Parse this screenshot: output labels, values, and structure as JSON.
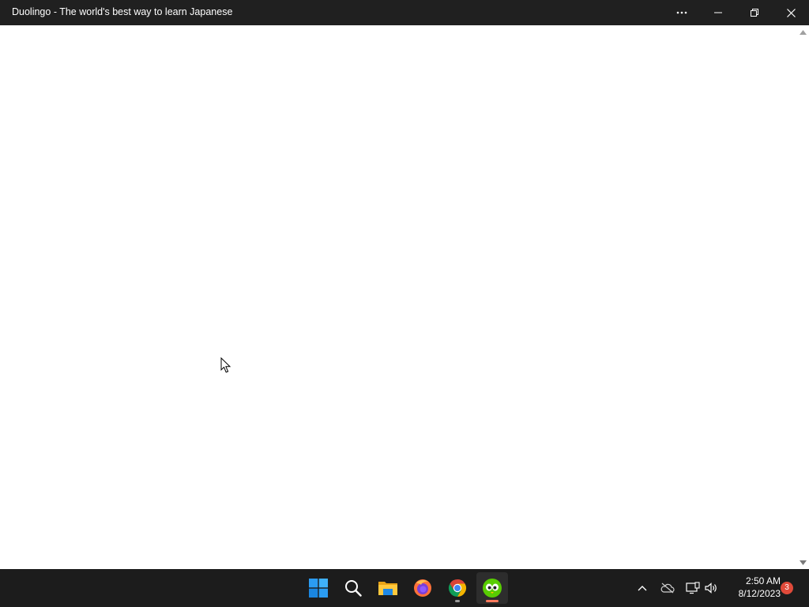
{
  "window": {
    "title": "Duolingo - The world's best way to learn Japanese",
    "controls": {
      "more_icon": "more-horizontal-icon",
      "minimize_icon": "minimize-icon",
      "restore_icon": "restore-icon",
      "close_icon": "close-icon"
    }
  },
  "colors": {
    "titlebar_bg": "#202020",
    "taskbar_bg": "#1c1c1c",
    "content_bg": "#ffffff",
    "duolingo_green": "#58cc02",
    "focused_indicator": "#ff7a5c",
    "notification_badge": "#e04a3a"
  },
  "taskbar": {
    "apps": [
      {
        "name": "Start",
        "icon": "windows-start-icon"
      },
      {
        "name": "Search",
        "icon": "search-icon"
      },
      {
        "name": "File Explorer",
        "icon": "folder-icon"
      },
      {
        "name": "Firefox",
        "icon": "firefox-icon"
      },
      {
        "name": "Google Chrome",
        "icon": "chrome-icon",
        "state": "running"
      },
      {
        "name": "Duolingo",
        "icon": "duolingo-icon",
        "state": "focused"
      }
    ],
    "tray": {
      "icons": [
        "chevron-up-icon",
        "onedrive-offline-icon",
        "network-icon",
        "volume-icon"
      ],
      "time": "2:50 AM",
      "date": "8/12/2023",
      "notification_count": "3"
    }
  }
}
